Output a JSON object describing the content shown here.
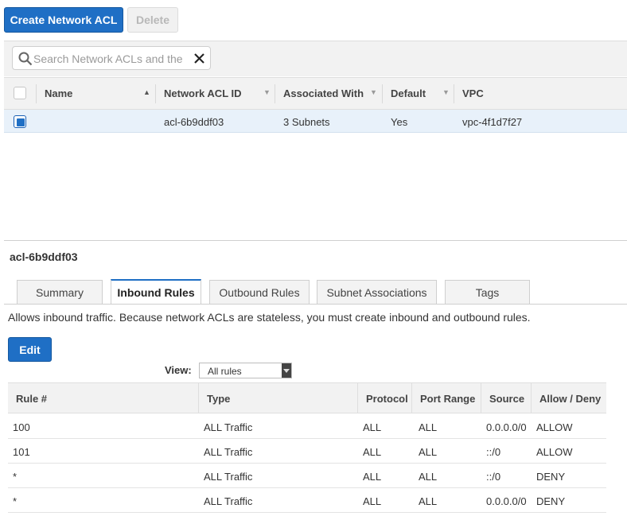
{
  "toolbar": {
    "create_label": "Create Network ACL",
    "delete_label": "Delete"
  },
  "search": {
    "placeholder": "Search Network ACLs and the"
  },
  "grid": {
    "columns": [
      "Name",
      "Network ACL ID",
      "Associated With",
      "Default",
      "VPC"
    ],
    "rows": [
      {
        "name": "",
        "acl_id": "acl-6b9ddf03",
        "associated": "3 Subnets",
        "default": "Yes",
        "vpc": "vpc-4f1d7f27",
        "selected": true
      }
    ]
  },
  "detail": {
    "title": "acl-6b9ddf03",
    "tabs": [
      "Summary",
      "Inbound Rules",
      "Outbound Rules",
      "Subnet Associations",
      "Tags"
    ],
    "active_tab": "Inbound Rules",
    "description": "Allows inbound traffic. Because network ACLs are stateless, you must create inbound and outbound rules.",
    "edit_label": "Edit",
    "view_label": "View:",
    "view_value": "All rules",
    "rules": {
      "columns": [
        "Rule #",
        "Type",
        "Protocol",
        "Port Range",
        "Source",
        "Allow / Deny"
      ],
      "rows": [
        {
          "rule": "100",
          "type": "ALL Traffic",
          "protocol": "ALL",
          "port": "ALL",
          "source": "0.0.0.0/0",
          "action": "ALLOW"
        },
        {
          "rule": "101",
          "type": "ALL Traffic",
          "protocol": "ALL",
          "port": "ALL",
          "source": "::/0",
          "action": "ALLOW"
        },
        {
          "rule": "*",
          "type": "ALL Traffic",
          "protocol": "ALL",
          "port": "ALL",
          "source": "::/0",
          "action": "DENY"
        },
        {
          "rule": "*",
          "type": "ALL Traffic",
          "protocol": "ALL",
          "port": "ALL",
          "source": "0.0.0.0/0",
          "action": "DENY"
        }
      ]
    }
  },
  "colors": {
    "primary": "#1f6fc5",
    "allow": "#2b9a2b",
    "deny": "#c0161a",
    "selected_row": "#e8f1fa"
  }
}
